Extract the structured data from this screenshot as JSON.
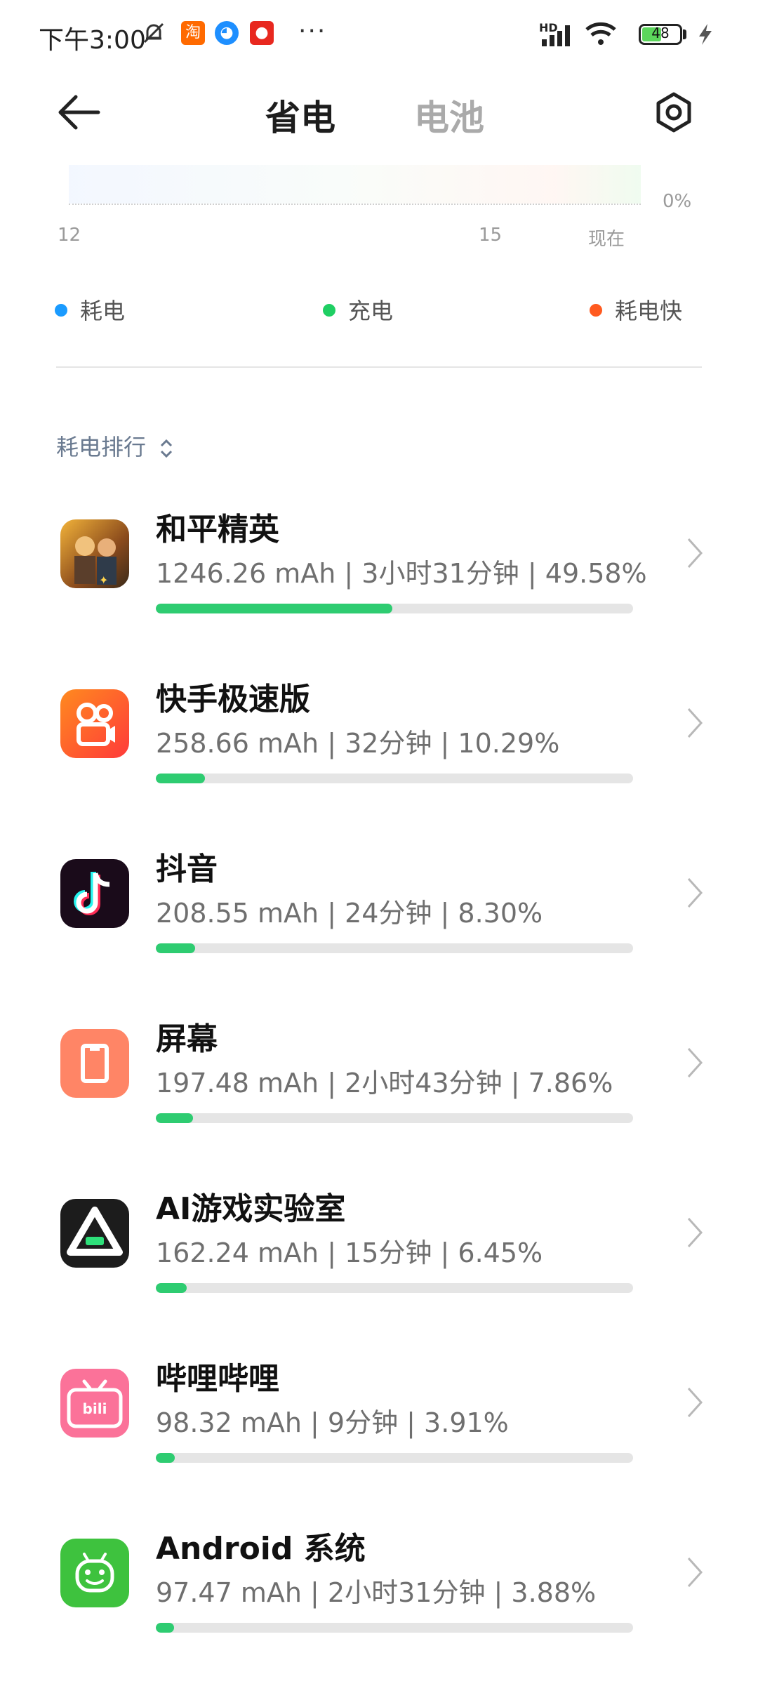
{
  "status_bar": {
    "time": "下午3:00",
    "notif_icons": [
      "mute-bell-icon",
      "taobao-app-icon",
      "qq-app-icon",
      "app-notification-icon"
    ],
    "overflow": "···",
    "network": "HD",
    "battery_level": "48"
  },
  "header": {
    "tab_active": "省电",
    "tab_inactive": "电池"
  },
  "chart": {
    "y_label": "0%",
    "x_ticks": [
      "12",
      "15",
      "现在"
    ]
  },
  "legend": [
    {
      "label": "耗电",
      "color": "#1a9bff"
    },
    {
      "label": "充电",
      "color": "#1fcf63"
    },
    {
      "label": "耗电快",
      "color": "#ff5a1f"
    }
  ],
  "sort": {
    "label": "耗电排行"
  },
  "apps": [
    {
      "name": "和平精英",
      "detail": "1246.26 mAh | 3小时31分钟 | 49.58%",
      "percent": 49.58,
      "icon": "game-peacekeeper-icon"
    },
    {
      "name": "快手极速版",
      "detail": "258.66 mAh | 32分钟 | 10.29%",
      "percent": 10.29,
      "icon": "kuaishou-icon"
    },
    {
      "name": "抖音",
      "detail": "208.55 mAh | 24分钟 | 8.30%",
      "percent": 8.3,
      "icon": "douyin-icon"
    },
    {
      "name": "屏幕",
      "detail": "197.48 mAh | 2小时43分钟 | 7.86%",
      "percent": 7.86,
      "icon": "screen-icon"
    },
    {
      "name": "AI游戏实验室",
      "detail": "162.24 mAh | 15分钟 | 6.45%",
      "percent": 6.45,
      "icon": "ai-game-lab-icon"
    },
    {
      "name": "哔哩哔哩",
      "detail": "98.32 mAh | 9分钟 | 3.91%",
      "percent": 3.91,
      "icon": "bilibili-icon"
    },
    {
      "name": "Android 系统",
      "detail": "97.47 mAh | 2小时31分钟 | 3.88%",
      "percent": 3.88,
      "icon": "android-icon"
    }
  ]
}
